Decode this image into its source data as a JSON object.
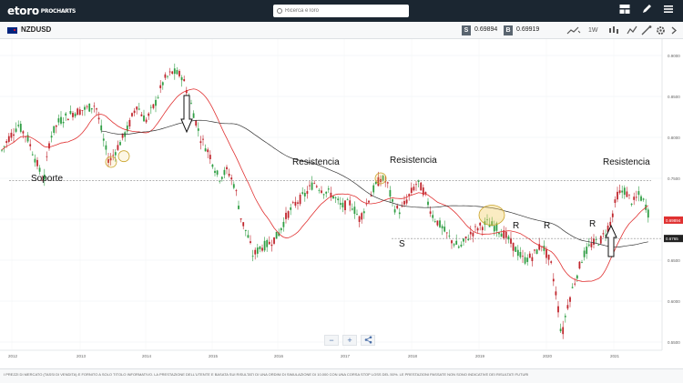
{
  "app": {
    "logo_text": "etoro",
    "logo_sub": "PROCHARTS",
    "search_placeholder": "Ricerca eToro"
  },
  "toolbar": {
    "symbol": "NZDUSD",
    "sell_label": "S",
    "sell_price": "0.69894",
    "buy_label": "B",
    "buy_price": "0.69919",
    "timeframe": "1W"
  },
  "chart_data": {
    "type": "candlestick",
    "x_tick_labels": [
      "2012",
      "2013",
      "2014",
      "2015",
      "2016",
      "2017",
      "2018",
      "2019",
      "2020",
      "2021"
    ],
    "y_tick_labels": [
      "0.9000",
      "0.8500",
      "0.8000",
      "0.7500",
      "0.7000",
      "0.6500",
      "0.6000",
      "0.5500"
    ],
    "ylim": [
      0.54,
      0.92
    ],
    "current_price_label": "0.69894",
    "level_label": "0.6765",
    "support_level": 0.747,
    "lower_level": 0.6765,
    "annotations": [
      "Soporte",
      "Resistencia",
      "Resistencia",
      "Resistencia",
      "S",
      "R",
      "R",
      "R"
    ],
    "colors": {
      "up": "#2f9e44",
      "down": "#c0262d",
      "ma_fast": "#e03131",
      "ma_slow": "#333333"
    }
  },
  "footer": {
    "disclaimer": "I PREZZI DI MERCATO (TASSI DI VENDITA) E FORNITO A SOLO TITOLO INFORMATIVO. LA PRESTAZIONE DELL'UTENTE E BASATA SUI RISULTATI DI UNA ORDINI DI SIMULAZIONE DI 10.000 CON UNA CORSA STOP LOSS DEL 50%. LE PRESTAZIONI PASSATE NON SONO INDICATIVE DEI RISULTATI FUTURI"
  },
  "controls": {
    "minus": "−",
    "plus": "+",
    "share": "<"
  }
}
